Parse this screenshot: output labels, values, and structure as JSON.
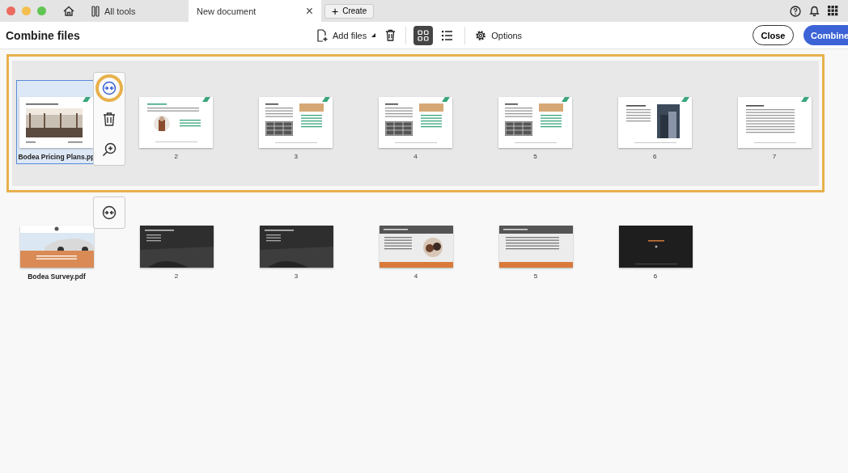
{
  "tabs": [
    {
      "label": "All tools",
      "selected": false,
      "kind": "tools"
    },
    {
      "label": "New document",
      "selected": true,
      "kind": "document",
      "close": "×"
    }
  ],
  "create_button": {
    "label": "Create",
    "icon": "+"
  },
  "toolbar": {
    "title": "Combine files",
    "add_files": "Add files",
    "views": [
      {
        "kind": "grid",
        "selected": true
      },
      {
        "kind": "list",
        "selected": false
      }
    ],
    "options": "Options",
    "close": "Close",
    "combine": "Combine"
  },
  "files": [
    {
      "name": "Bodea Pricing Plans.pp",
      "selected": true,
      "outlined": true,
      "actions": [
        {
          "kind": "collapse",
          "highlighted": true
        },
        {
          "kind": "delete",
          "highlighted": false
        },
        {
          "kind": "zoom",
          "highlighted": false
        }
      ],
      "pages": [
        {
          "kind": "photo-light"
        },
        {
          "label": "2",
          "kind": "portrait-light"
        },
        {
          "label": "3",
          "kind": "table-light"
        },
        {
          "label": "4",
          "kind": "table-light"
        },
        {
          "label": "5",
          "kind": "table-light"
        },
        {
          "label": "6",
          "kind": "photo-side"
        },
        {
          "label": "7",
          "kind": "text-light"
        }
      ]
    },
    {
      "name": "Bodea Survey.pdf",
      "selected": false,
      "outlined": false,
      "actions": [
        {
          "kind": "collapse",
          "highlighted": false
        }
      ],
      "pages": [
        {
          "kind": "cover-orange"
        },
        {
          "label": "2",
          "kind": "road-dark"
        },
        {
          "label": "3",
          "kind": "road-dark"
        },
        {
          "label": "4",
          "kind": "people-orange"
        },
        {
          "label": "5",
          "kind": "list-orange"
        },
        {
          "label": "6",
          "kind": "end-dark"
        }
      ]
    }
  ]
}
